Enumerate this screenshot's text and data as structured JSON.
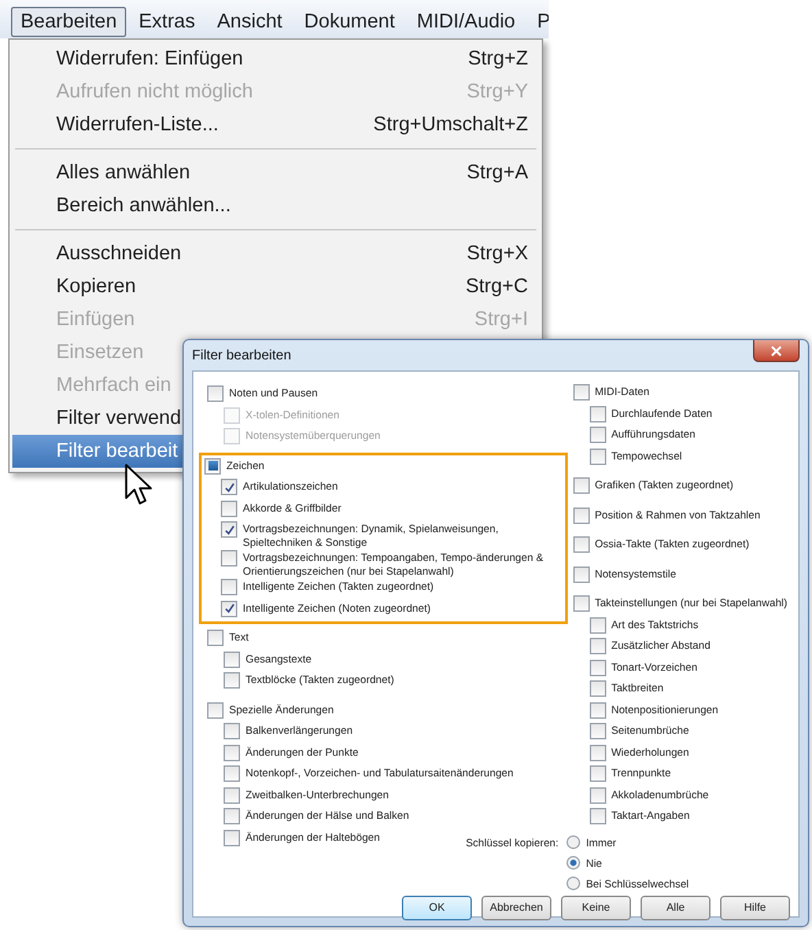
{
  "menubar": {
    "items": [
      {
        "label": "Bearbeiten",
        "selected": true
      },
      {
        "label": "Extras",
        "selected": false
      },
      {
        "label": "Ansicht",
        "selected": false
      },
      {
        "label": "Dokument",
        "selected": false
      },
      {
        "label": "MIDI/Audio",
        "selected": false
      },
      {
        "label": "P",
        "selected": false
      }
    ]
  },
  "menu": {
    "entries": [
      {
        "kind": "item",
        "label": "Widerrufen: Einfügen",
        "shortcut": "Strg+Z",
        "disabled": false,
        "selected": false
      },
      {
        "kind": "item",
        "label": "Aufrufen nicht möglich",
        "shortcut": "Strg+Y",
        "disabled": true,
        "selected": false
      },
      {
        "kind": "item",
        "label": "Widerrufen-Liste...",
        "shortcut": "Strg+Umschalt+Z",
        "disabled": false,
        "selected": false
      },
      {
        "kind": "separator"
      },
      {
        "kind": "item",
        "label": "Alles anwählen",
        "shortcut": "Strg+A",
        "disabled": false,
        "selected": false
      },
      {
        "kind": "item",
        "label": "Bereich anwählen...",
        "disabled": false,
        "selected": false
      },
      {
        "kind": "separator"
      },
      {
        "kind": "item",
        "label": "Ausschneiden",
        "shortcut": "Strg+X",
        "disabled": false,
        "selected": false
      },
      {
        "kind": "item",
        "label": "Kopieren",
        "shortcut": "Strg+C",
        "disabled": false,
        "selected": false
      },
      {
        "kind": "item",
        "label": "Einfügen",
        "shortcut": "Strg+I",
        "disabled": true,
        "selected": false
      },
      {
        "kind": "item",
        "label": "Einsetzen",
        "disabled": true,
        "selected": false
      },
      {
        "kind": "item",
        "label": "Mehrfach ein",
        "disabled": true,
        "selected": false
      },
      {
        "kind": "item",
        "label": "Filter verwend",
        "disabled": false,
        "selected": false
      },
      {
        "kind": "item",
        "label": "Filter bearbeit",
        "disabled": false,
        "selected": true
      }
    ]
  },
  "dialog": {
    "title": "Filter bearbeiten",
    "left": [
      {
        "label": "Noten und Pausen",
        "checked": false,
        "partial": false,
        "disabled": false,
        "highlighted": false,
        "children": [
          {
            "label": "X-tolen-Definitionen",
            "checked": false,
            "disabled": true
          },
          {
            "label": "Notensystemüberquerungen",
            "checked": false,
            "disabled": true
          }
        ]
      },
      {
        "label": "Zeichen",
        "checked": false,
        "partial": true,
        "disabled": false,
        "highlighted": true,
        "children": [
          {
            "label": "Artikulationszeichen",
            "checked": true,
            "disabled": false
          },
          {
            "label": "Akkorde & Griffbilder",
            "checked": false,
            "disabled": false
          },
          {
            "label": "Vortragsbezeichnungen: Dynamik, Spielanweisungen, Spieltechniken & Sonstige",
            "checked": true,
            "disabled": false
          },
          {
            "label": "Vortragsbezeichnungen: Tempoangaben, Tempo-änderungen & Orientierungszeichen (nur bei Stapelanwahl)",
            "checked": false,
            "disabled": false
          },
          {
            "label": "Intelligente Zeichen (Takten zugeordnet)",
            "checked": false,
            "disabled": false
          },
          {
            "label": "Intelligente Zeichen (Noten zugeordnet)",
            "checked": true,
            "disabled": false
          }
        ]
      },
      {
        "label": "Text",
        "checked": false,
        "partial": false,
        "disabled": false,
        "highlighted": false,
        "children": [
          {
            "label": "Gesangstexte",
            "checked": false,
            "disabled": false
          },
          {
            "label": "Textblöcke (Takten zugeordnet)",
            "checked": false,
            "disabled": false
          }
        ]
      },
      {
        "label": "Spezielle Änderungen",
        "checked": false,
        "partial": false,
        "disabled": false,
        "highlighted": false,
        "children": [
          {
            "label": "Balkenverlängerungen",
            "checked": false,
            "disabled": false
          },
          {
            "label": "Änderungen der Punkte",
            "checked": false,
            "disabled": false
          },
          {
            "label": "Notenkopf-, Vorzeichen- und Tabulatursaitenänderungen",
            "checked": false,
            "disabled": false
          },
          {
            "label": "Zweitbalken-Unterbrechungen",
            "checked": false,
            "disabled": false
          },
          {
            "label": "Änderungen der Hälse und Balken",
            "checked": false,
            "disabled": false
          },
          {
            "label": "Änderungen der Haltebögen",
            "checked": false,
            "disabled": false
          }
        ]
      }
    ],
    "right": [
      {
        "label": "MIDI-Daten",
        "checked": false,
        "partial": false,
        "disabled": false,
        "highlighted": false,
        "children": [
          {
            "label": "Durchlaufende Daten",
            "checked": false,
            "disabled": false
          },
          {
            "label": "Aufführungsdaten",
            "checked": false,
            "disabled": false
          },
          {
            "label": "Tempowechsel",
            "checked": false,
            "disabled": false
          }
        ]
      },
      {
        "label": "Grafiken (Takten zugeordnet)",
        "checked": false,
        "partial": false,
        "disabled": false,
        "highlighted": false
      },
      {
        "label": "Position & Rahmen von Taktzahlen",
        "checked": false,
        "partial": false,
        "disabled": false,
        "highlighted": false
      },
      {
        "label": "Ossia-Takte (Takten zugeordnet)",
        "checked": false,
        "partial": false,
        "disabled": false,
        "highlighted": false
      },
      {
        "label": "Notensystemstile",
        "checked": false,
        "partial": false,
        "disabled": false,
        "highlighted": false
      },
      {
        "label": "Takteinstellungen (nur bei Stapelanwahl)",
        "checked": false,
        "partial": false,
        "disabled": false,
        "highlighted": false,
        "children": [
          {
            "label": "Art des Taktstrichs",
            "checked": false,
            "disabled": false
          },
          {
            "label": "Zusätzlicher Abstand",
            "checked": false,
            "disabled": false
          },
          {
            "label": "Tonart-Vorzeichen",
            "checked": false,
            "disabled": false
          },
          {
            "label": "Taktbreiten",
            "checked": false,
            "disabled": false
          },
          {
            "label": "Notenpositionierungen",
            "checked": false,
            "disabled": false
          },
          {
            "label": "Seitenumbrüche",
            "checked": false,
            "disabled": false
          },
          {
            "label": "Wiederholungen",
            "checked": false,
            "disabled": false
          },
          {
            "label": "Trennpunkte",
            "checked": false,
            "disabled": false
          },
          {
            "label": "Akkoladenumbrüche",
            "checked": false,
            "disabled": false
          },
          {
            "label": "Taktart-Angaben",
            "checked": false,
            "disabled": false
          }
        ]
      }
    ],
    "copy_clefs": {
      "label": "Schlüssel kopieren:",
      "options": [
        {
          "label": "Immer",
          "selected": false
        },
        {
          "label": "Nie",
          "selected": true
        },
        {
          "label": "Bei Schlüsselwechsel",
          "selected": false
        }
      ]
    },
    "buttons": [
      {
        "label": "OK",
        "default": true
      },
      {
        "label": "Abbrechen",
        "default": false
      },
      {
        "label": "Keine",
        "default": false
      },
      {
        "label": "Alle",
        "default": false
      },
      {
        "label": "Hilfe",
        "default": false
      }
    ]
  }
}
